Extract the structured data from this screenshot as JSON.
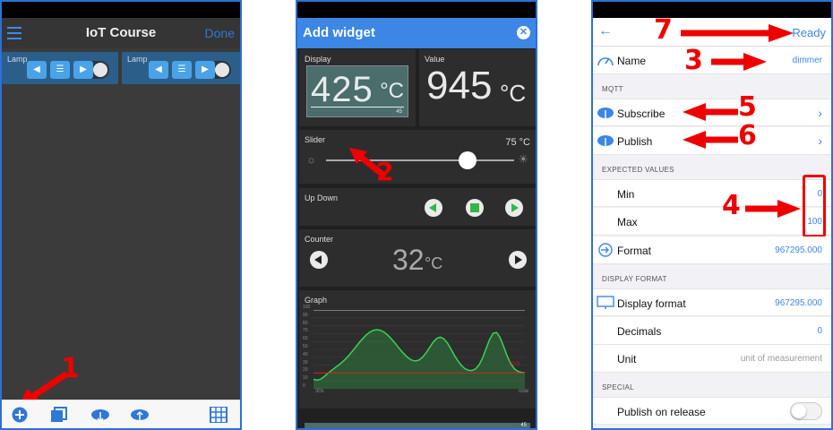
{
  "phone1": {
    "title": "IoT Course",
    "done": "Done",
    "lamp_cards": [
      {
        "label": "Lamp"
      },
      {
        "label": "Lamp"
      }
    ],
    "annotation": "1",
    "bottom_icons": [
      "add-icon",
      "copy-icon",
      "cloud-download-icon",
      "cloud-upload-icon",
      "grid-icon"
    ]
  },
  "phone2": {
    "title": "Add widget",
    "display": {
      "label": "Display",
      "value": "425",
      "unit": "°C",
      "small": "45"
    },
    "value_panel": {
      "label": "Value",
      "value": "945",
      "unit": "°C"
    },
    "slider": {
      "label": "Slider",
      "value": "75 °C",
      "annotation": "2",
      "level": 0.75
    },
    "updown": {
      "label": "Up Down"
    },
    "counter": {
      "label": "Counter",
      "value": "32",
      "unit": "°C"
    },
    "graph": {
      "label": "Graph",
      "y_ticks": [
        "100",
        "90",
        "80",
        "70",
        "60",
        "50",
        "40",
        "30",
        "20",
        "10",
        "0"
      ],
      "x_start": "30s",
      "x_end": "now",
      "threshold": 20,
      "threshold_label": "20.0",
      "color_line": "#39d353",
      "color_threshold": "#d82020"
    },
    "bottom_small": "45"
  },
  "phone3": {
    "ready": "Ready",
    "name": {
      "label": "Name",
      "value": "dimmer"
    },
    "mqtt_section": "MQTT",
    "subscribe": "Subscribe",
    "publish": "Publish",
    "expected_section": "EXPECTED VALUES",
    "min": {
      "label": "Min",
      "value": "0"
    },
    "max": {
      "label": "Max",
      "value": "100"
    },
    "format": {
      "label": "Format",
      "value": "967295.000"
    },
    "display_section": "DISPLAY FORMAT",
    "display_format": {
      "label": "Display format",
      "value": "967295.000"
    },
    "decimals": {
      "label": "Decimals",
      "value": "0"
    },
    "unit": {
      "label": "Unit",
      "placeholder": "unit of measurement"
    },
    "special_section": "SPECIAL",
    "publish_on_release": "Publish on release",
    "annotations": {
      "a3": "3",
      "a4": "4",
      "a5": "5",
      "a6": "6",
      "a7": "7"
    }
  },
  "colors": {
    "accent": "#3c86e6",
    "annotation": "#e00000"
  }
}
